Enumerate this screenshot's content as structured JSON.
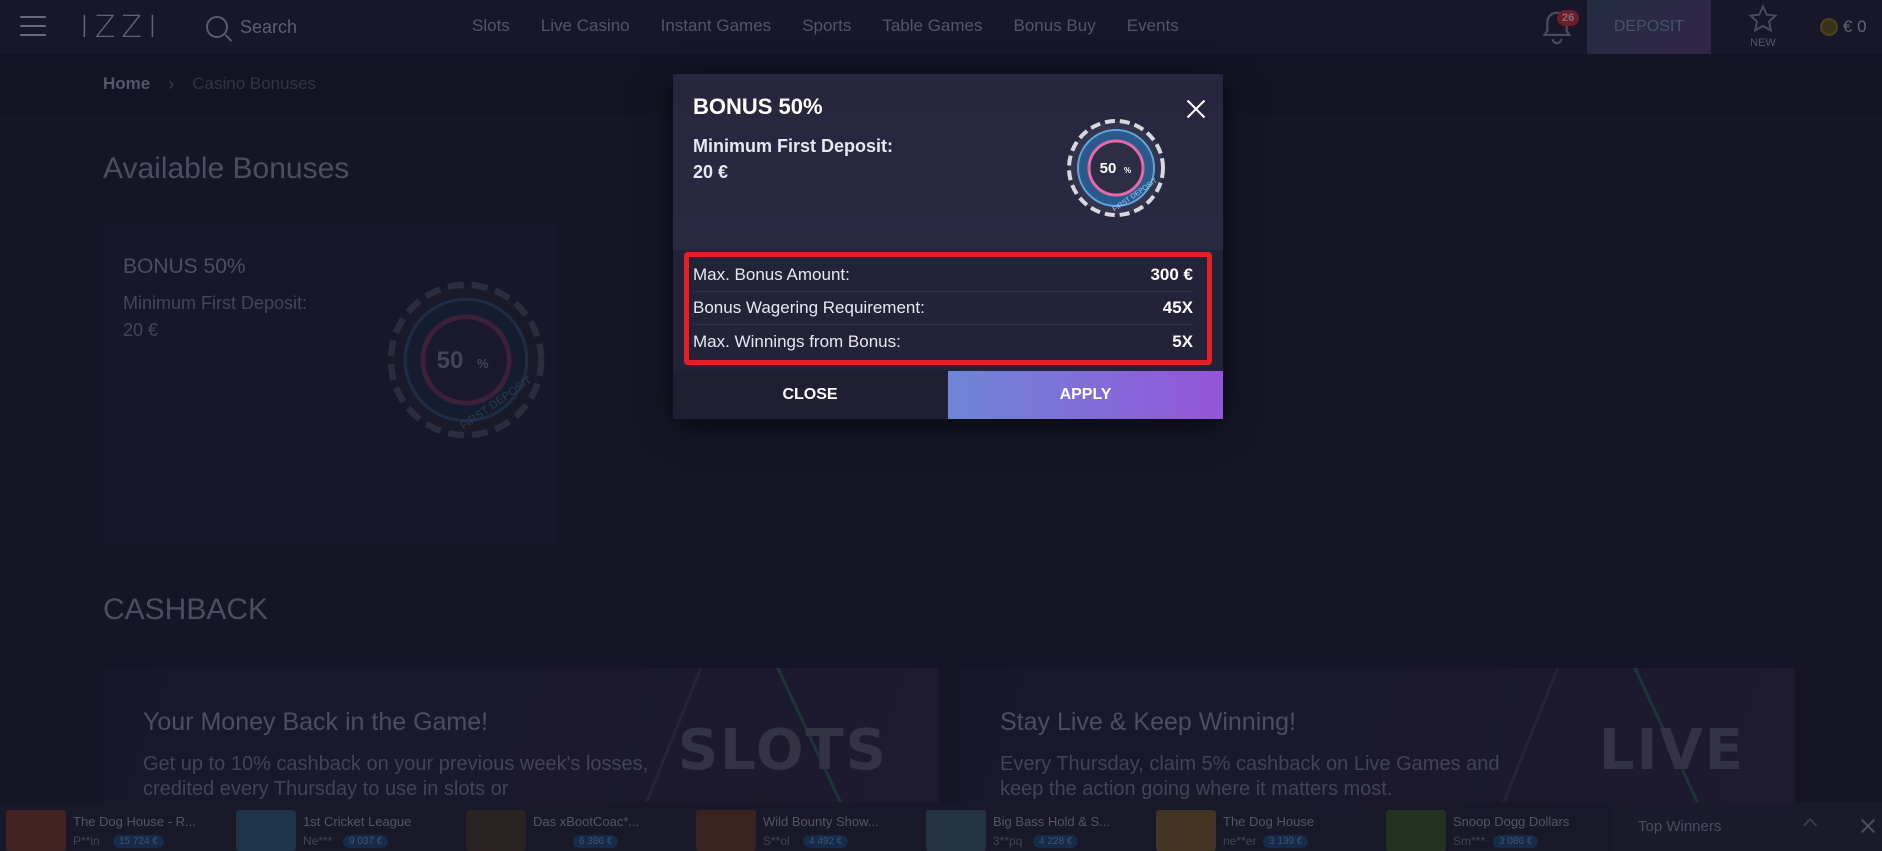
{
  "header": {
    "logo": "IZZI",
    "search_label": "Search",
    "nav": [
      "Slots",
      "Live Casino",
      "Instant Games",
      "Sports",
      "Table Games",
      "Bonus Buy",
      "Events"
    ],
    "notification_count": "26",
    "deposit_label": "DEPOSIT",
    "new_label": "NEW",
    "balance": "€ 0"
  },
  "breadcrumb": {
    "home": "Home",
    "current": "Casino Bonuses"
  },
  "main": {
    "available_title": "Available Bonuses",
    "bonus_card": {
      "title": "BONUS 50%",
      "min_label": "Minimum First Deposit:",
      "min_amount": "20 €"
    },
    "cashback_title": "CASHBACK",
    "promos": [
      {
        "title": "Your Money Back in the Game!",
        "desc": "Get up to 10% cashback on your previous week's losses, credited every Thursday to use in slots or",
        "big_text": "SLOTS"
      },
      {
        "title": "Stay Live & Keep Winning!",
        "desc": "Every Thursday, claim 5% cashback on Live Games and keep the action going where it matters most.",
        "big_text": "LIVE"
      }
    ]
  },
  "chip": {
    "percent": "50",
    "percent_sign": "%",
    "caption": "FIRST DEPOSIT"
  },
  "modal": {
    "title": "BONUS 50%",
    "min_label": "Minimum First Deposit:",
    "min_amount": "20 €",
    "rows": [
      {
        "label": "Max. Bonus Amount:",
        "value": "300 €"
      },
      {
        "label": "Bonus Wagering Requirement:",
        "value": "45X"
      },
      {
        "label": "Max. Winnings from Bonus:",
        "value": "5X"
      }
    ],
    "close_label": "CLOSE",
    "apply_label": "APPLY"
  },
  "ticker": {
    "items": [
      {
        "name": "The Dog House - R...",
        "user": "P**in",
        "amount": "15 724 €",
        "color": "#7a3b2c"
      },
      {
        "name": "1st Cricket League",
        "user": "Ne***",
        "amount": "9 037 €",
        "color": "#2f5a7a"
      },
      {
        "name": "Das xBootCoac*...",
        "user": "",
        "amount": "6 386 €",
        "color": "#4a3a2a"
      },
      {
        "name": "Wild Bounty Show...",
        "user": "S**ol",
        "amount": "4 492 €",
        "color": "#6a3a2c"
      },
      {
        "name": "Big Bass Hold & S...",
        "user": "3**pq",
        "amount": "4 228 €",
        "color": "#3a5a6a"
      },
      {
        "name": "The Dog House",
        "user": "ne**er",
        "amount": "3 139 €",
        "color": "#7a5a2c"
      },
      {
        "name": "Snoop Dogg Dollars",
        "user": "Sm***",
        "amount": "3 086 €",
        "color": "#3a5a2c"
      }
    ],
    "top_winners_label": "Top Winners"
  }
}
